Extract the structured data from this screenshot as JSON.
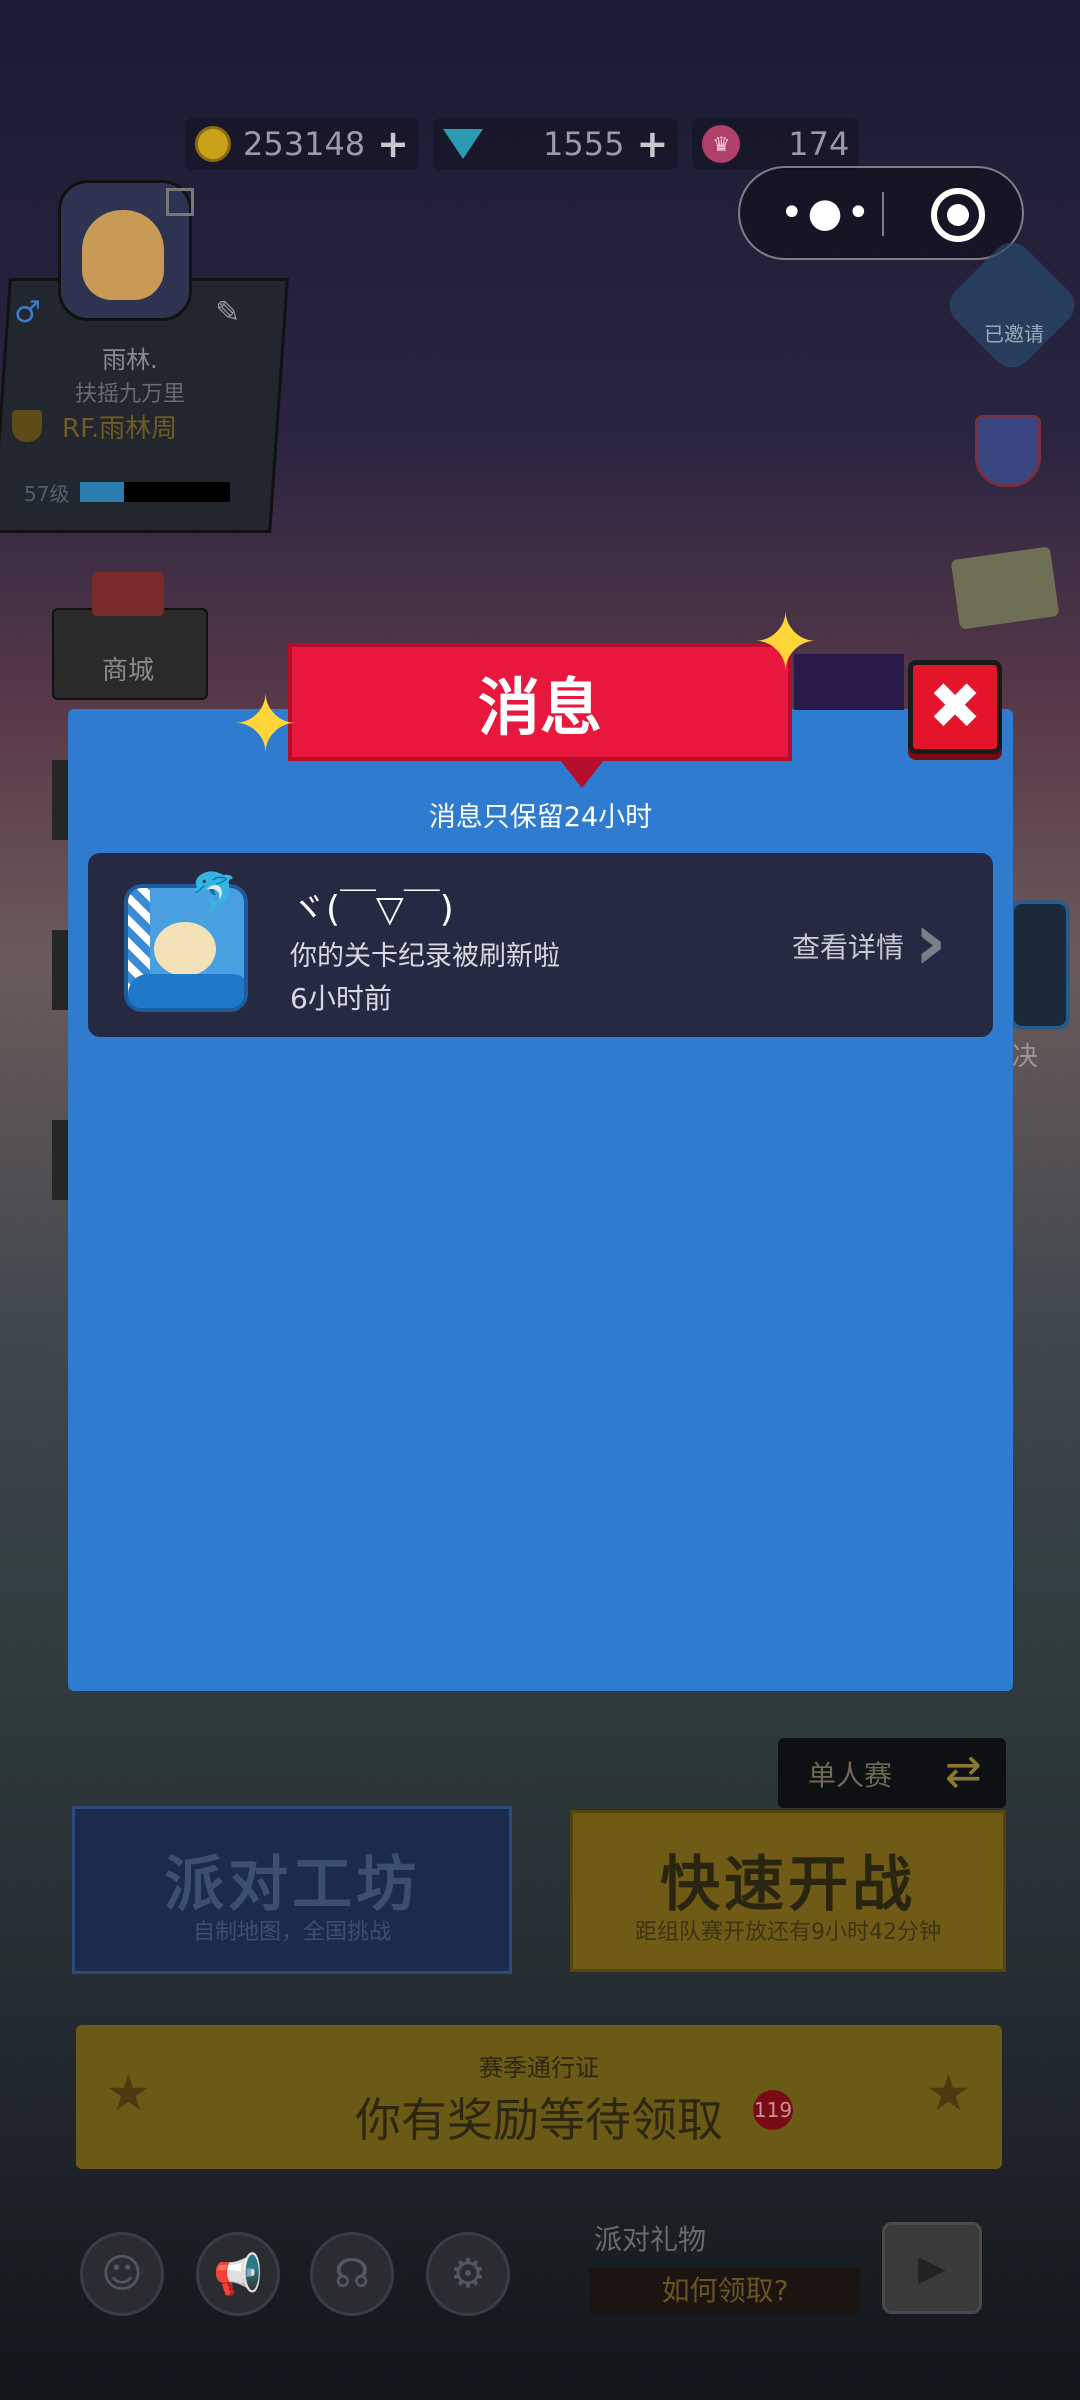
{
  "currency": {
    "coins": "253148",
    "gems": "1555",
    "tickets": "174",
    "coin_icon": "gold-coin-icon",
    "gem_icon": "diamond-icon",
    "ticket_icon": "ticket-icon"
  },
  "profile": {
    "name": "雨林.",
    "subtitle": "扶摇九万里",
    "club": "RF.雨林周",
    "level": "57级"
  },
  "side": {
    "shop_label": "商城",
    "right_badge": "已邀请",
    "right_edge_text": "决"
  },
  "modal": {
    "title": "消息",
    "note": "消息只保留24小时",
    "close_symbol": "✖",
    "messages": [
      {
        "sender": "ヾ(￣▽￣)",
        "text": "你的关卡纪录被刷新啦",
        "time": "6小时前",
        "detail": "查看详情"
      }
    ]
  },
  "bottom": {
    "mode_label": "单人赛",
    "workshop_title": "派对工坊",
    "workshop_sub": "自制地图，全国挑战",
    "quick_title": "快速开战",
    "quick_sub": "距组队赛开放还有9小时42分钟",
    "pass_title": "赛季通行证",
    "pass_main": "你有奖励等待领取",
    "pass_badge": "119",
    "gift_label": "派对礼物",
    "gift_how": "如何领取?"
  },
  "colors": {
    "modal_bg": "#2f7bcf",
    "ribbon": "#e8173d",
    "close": "#e4152b",
    "message_card": "#252a42"
  }
}
